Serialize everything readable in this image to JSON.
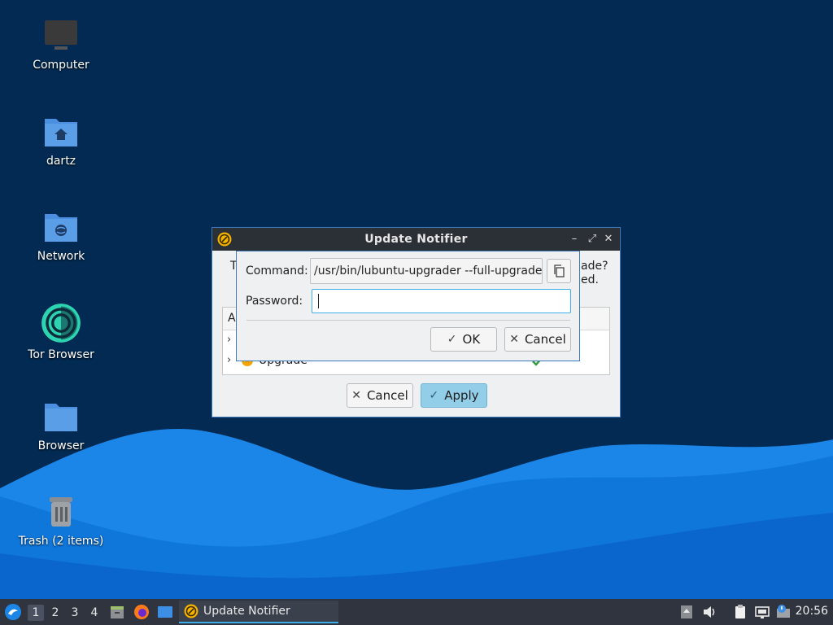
{
  "desktop": {
    "icons": [
      {
        "label": "Computer",
        "icon": "computer-icon"
      },
      {
        "label": "dartz",
        "icon": "home-folder-icon"
      },
      {
        "label": "Network",
        "icon": "network-folder-icon"
      },
      {
        "label": "Tor Browser",
        "icon": "tor-browser-icon"
      },
      {
        "label": "Browser",
        "icon": "folder-icon"
      },
      {
        "label": "Trash (2 items)",
        "icon": "trash-icon"
      }
    ]
  },
  "main_window": {
    "title": "Update Notifier",
    "question_start": "T",
    "question_end_1": "ade?",
    "question_end_2": "ed.",
    "tree_header_start": "A",
    "tree_rows": [
      "Upgrade"
    ],
    "cancel_label": "Cancel",
    "apply_label": "Apply"
  },
  "sudo_dialog": {
    "command_label": "Command:",
    "command_value": "/usr/bin/lubuntu-upgrader --full-upgrade",
    "password_label": "Password:",
    "password_value": "",
    "ok_label": "OK",
    "cancel_label": "Cancel"
  },
  "taskbar": {
    "workspaces": [
      "1",
      "2",
      "3",
      "4"
    ],
    "active_workspace": "1",
    "task_label": "Update Notifier",
    "clock": "20:56"
  },
  "colors": {
    "desktop_bg": "#022a52",
    "accent": "#3daee9",
    "titlebar": "#2b2f36",
    "taskbar": "#2f343f"
  }
}
